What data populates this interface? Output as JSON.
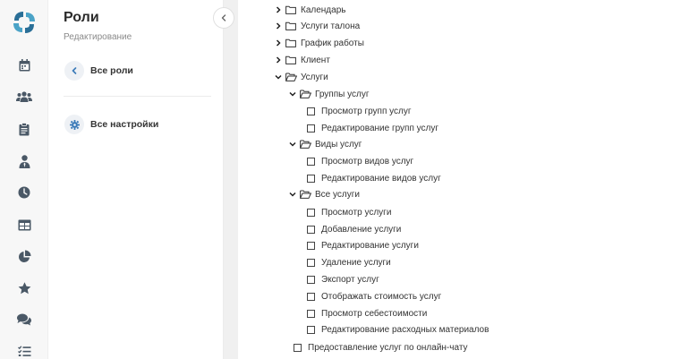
{
  "sidebar": {
    "icons": [
      "calendar-icon",
      "users-icon",
      "clipboard-icon",
      "user-tie-icon",
      "clock-icon",
      "table-icon",
      "pie-chart-icon",
      "star-icon",
      "comments-icon",
      "list-check-icon"
    ]
  },
  "panel": {
    "title": "Роли",
    "subtitle": "Редактирование",
    "back_label": "Все роли",
    "settings_label": "Все настройки"
  },
  "tree": {
    "calendar": "Календарь",
    "ticket_services": "Услуги талона",
    "work_schedule": "График работы",
    "client": "Клиент",
    "services": "Услуги",
    "service_groups": {
      "label": "Группы услуг",
      "items": [
        "Просмотр групп услуг",
        "Редактирование групп услуг"
      ]
    },
    "service_types": {
      "label": "Виды услуг",
      "items": [
        "Просмотр видов услуг",
        "Редактирование видов услуг"
      ]
    },
    "all_services": {
      "label": "Все услуги",
      "items": [
        "Просмотр услуги",
        "Добавление услуги",
        "Редактирование услуги",
        "Удаление услуги",
        "Экспорт услуг",
        "Отображать стоимость услуг",
        "Просмотр себестоимости",
        "Редактирование расходных материалов"
      ]
    },
    "online_chat": "Предоставление услуг по онлайн-чату"
  },
  "colors": {
    "brand": "#2a6f97",
    "brand_light": "#4ba3c7",
    "icon": "#4a5866",
    "settings_icon": "#3a7ab8"
  }
}
